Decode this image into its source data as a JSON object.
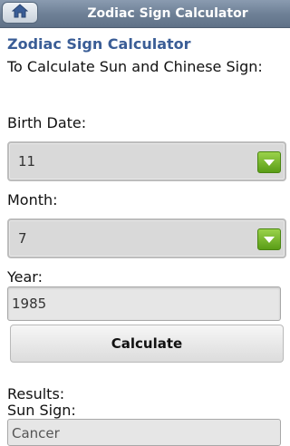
{
  "header": {
    "title": "Zodiac Sign Calculator",
    "home_icon": "home-icon"
  },
  "form": {
    "heading": "Zodiac Sign Calculator",
    "intro": "To Calculate Sun and Chinese Sign:",
    "birth_date_label": "Birth Date:",
    "birth_date_value": "11",
    "month_label": "Month:",
    "month_value": "7",
    "year_label": "Year:",
    "year_value": "1985",
    "calculate_label": "Calculate"
  },
  "results": {
    "label": "Results:",
    "sun_sign_label": "Sun Sign:",
    "sun_sign_value": "Cancer"
  },
  "colors": {
    "heading": "#3a5d96",
    "dropdown_arrow": "#6aab22",
    "topbar": "#6f8197"
  }
}
